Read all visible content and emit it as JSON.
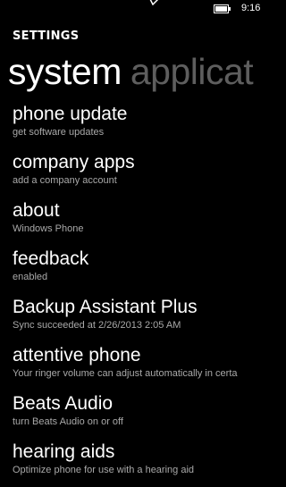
{
  "status_bar": {
    "time": "9:16",
    "icons": [
      "signal-icon",
      "battery-icon"
    ]
  },
  "app_title": "SETTINGS",
  "pivot": {
    "active_tab": "system",
    "next_tab": "applicat"
  },
  "colors": {
    "background": "#000000",
    "text": "#ffffff",
    "subtext": "#a9a9a9",
    "inactive_tab": "#5e5e5e"
  },
  "items": [
    {
      "title": "phone update",
      "subtitle": "get software updates"
    },
    {
      "title": "company apps",
      "subtitle": "add a company account"
    },
    {
      "title": "about",
      "subtitle": "Windows Phone"
    },
    {
      "title": "feedback",
      "subtitle": "enabled"
    },
    {
      "title": "Backup Assistant Plus",
      "subtitle": "Sync succeeded at 2/26/2013 2:05 AM"
    },
    {
      "title": "attentive phone",
      "subtitle": "Your ringer volume can adjust automatically in certa"
    },
    {
      "title": "Beats Audio",
      "subtitle": "turn Beats Audio on or off"
    },
    {
      "title": "hearing aids",
      "subtitle": "Optimize phone for use with a hearing aid"
    }
  ]
}
